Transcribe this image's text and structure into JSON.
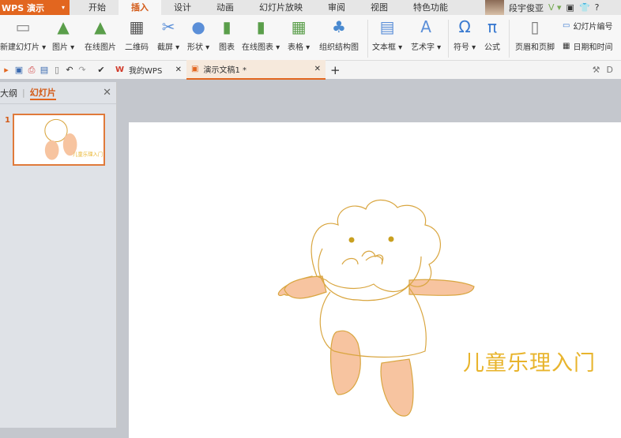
{
  "app": {
    "name": "WPS 演示"
  },
  "menu": {
    "tabs": [
      "开始",
      "插入",
      "设计",
      "动画",
      "幻灯片放映",
      "审阅",
      "视图",
      "特色功能"
    ],
    "active": "插入"
  },
  "user": {
    "name": "段宇俊亚",
    "help": "?"
  },
  "ribbon": {
    "items": [
      {
        "label": "新建幻灯片 ▾",
        "icon": "new-slide-icon"
      },
      {
        "label": "图片 ▾",
        "icon": "picture-icon"
      },
      {
        "label": "在线图片",
        "icon": "online-picture-icon"
      },
      {
        "label": "二维码",
        "icon": "qrcode-icon"
      },
      {
        "label": "截屏 ▾",
        "icon": "screenshot-icon"
      },
      {
        "label": "形状 ▾",
        "icon": "shapes-icon"
      },
      {
        "label": "图表",
        "icon": "chart-icon"
      },
      {
        "label": "在线图表 ▾",
        "icon": "online-chart-icon"
      },
      {
        "label": "表格 ▾",
        "icon": "table-icon"
      },
      {
        "label": "组织结构图",
        "icon": "org-chart-icon"
      },
      {
        "label": "文本框 ▾",
        "icon": "textbox-icon"
      },
      {
        "label": "艺术字 ▾",
        "icon": "wordart-icon"
      },
      {
        "label": "符号 ▾",
        "icon": "omega-icon"
      },
      {
        "label": "公式",
        "icon": "pi-icon"
      },
      {
        "label": "页眉和页脚",
        "icon": "header-footer-icon"
      }
    ],
    "slide_number": "幻灯片编号",
    "date_time": "日期和时间"
  },
  "doctabs": [
    {
      "label": "我的WPS"
    },
    {
      "label": "演示文稿1 *"
    }
  ],
  "side": {
    "outline": "大纲",
    "slides": "幻灯片",
    "slide_index": "1"
  },
  "slide": {
    "title": "儿童乐理入门"
  },
  "colors": {
    "accent": "#e2661f",
    "title": "#e8b42c"
  }
}
